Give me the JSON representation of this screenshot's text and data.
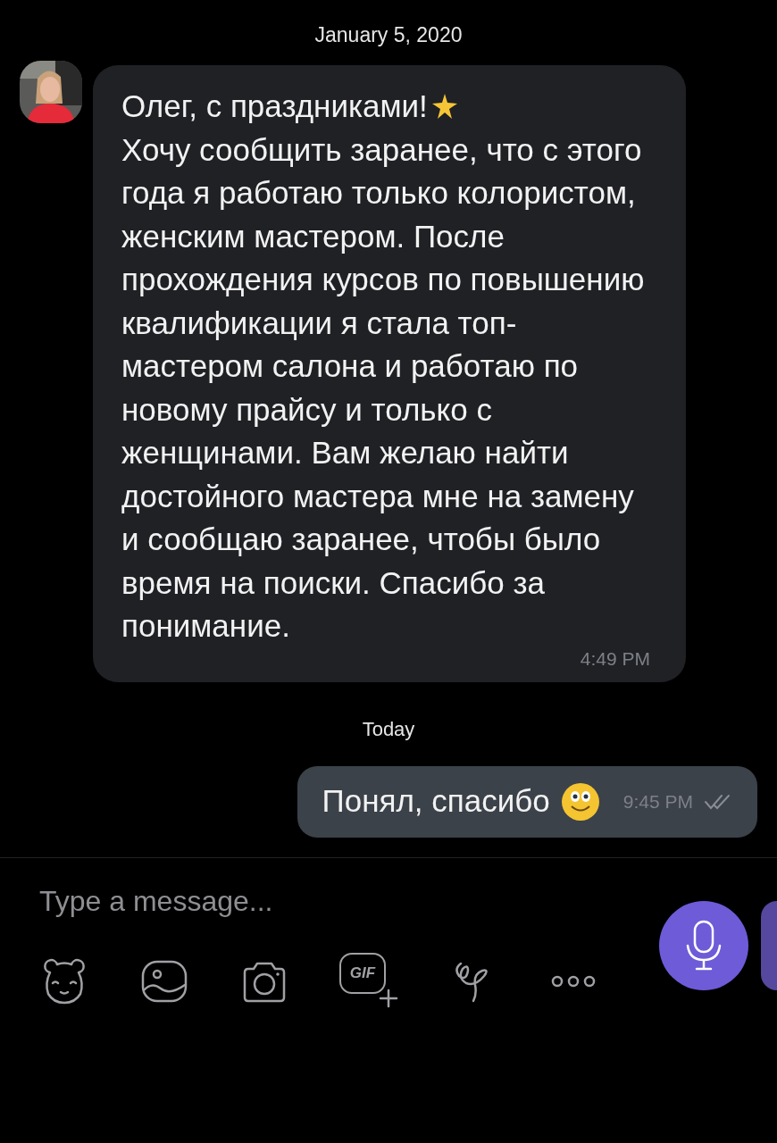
{
  "chat": [
    {
      "kind": "date",
      "text": "January 5, 2020"
    },
    {
      "kind": "incoming",
      "first_line": "Олег, с праздниками!",
      "body": "Хочу сообщить заранее, что с этого года я работаю только колористом, женским мастером. После прохождения курсов по повышению квалификации я стала топ-мастером салона и работаю по новому прайсу и только с женщинами. Вам желаю найти достойного мастера мне на замену и сообщаю заранее, чтобы было время на поиски. Спасибо за понимание.",
      "time": "4:49 PM"
    },
    {
      "kind": "date",
      "text": "Today"
    },
    {
      "kind": "outgoing",
      "text": "Понял, спасибо",
      "time": "9:45 PM",
      "read": true
    }
  ],
  "composer": {
    "placeholder": "Type a message...",
    "gif_label": "GIF"
  }
}
